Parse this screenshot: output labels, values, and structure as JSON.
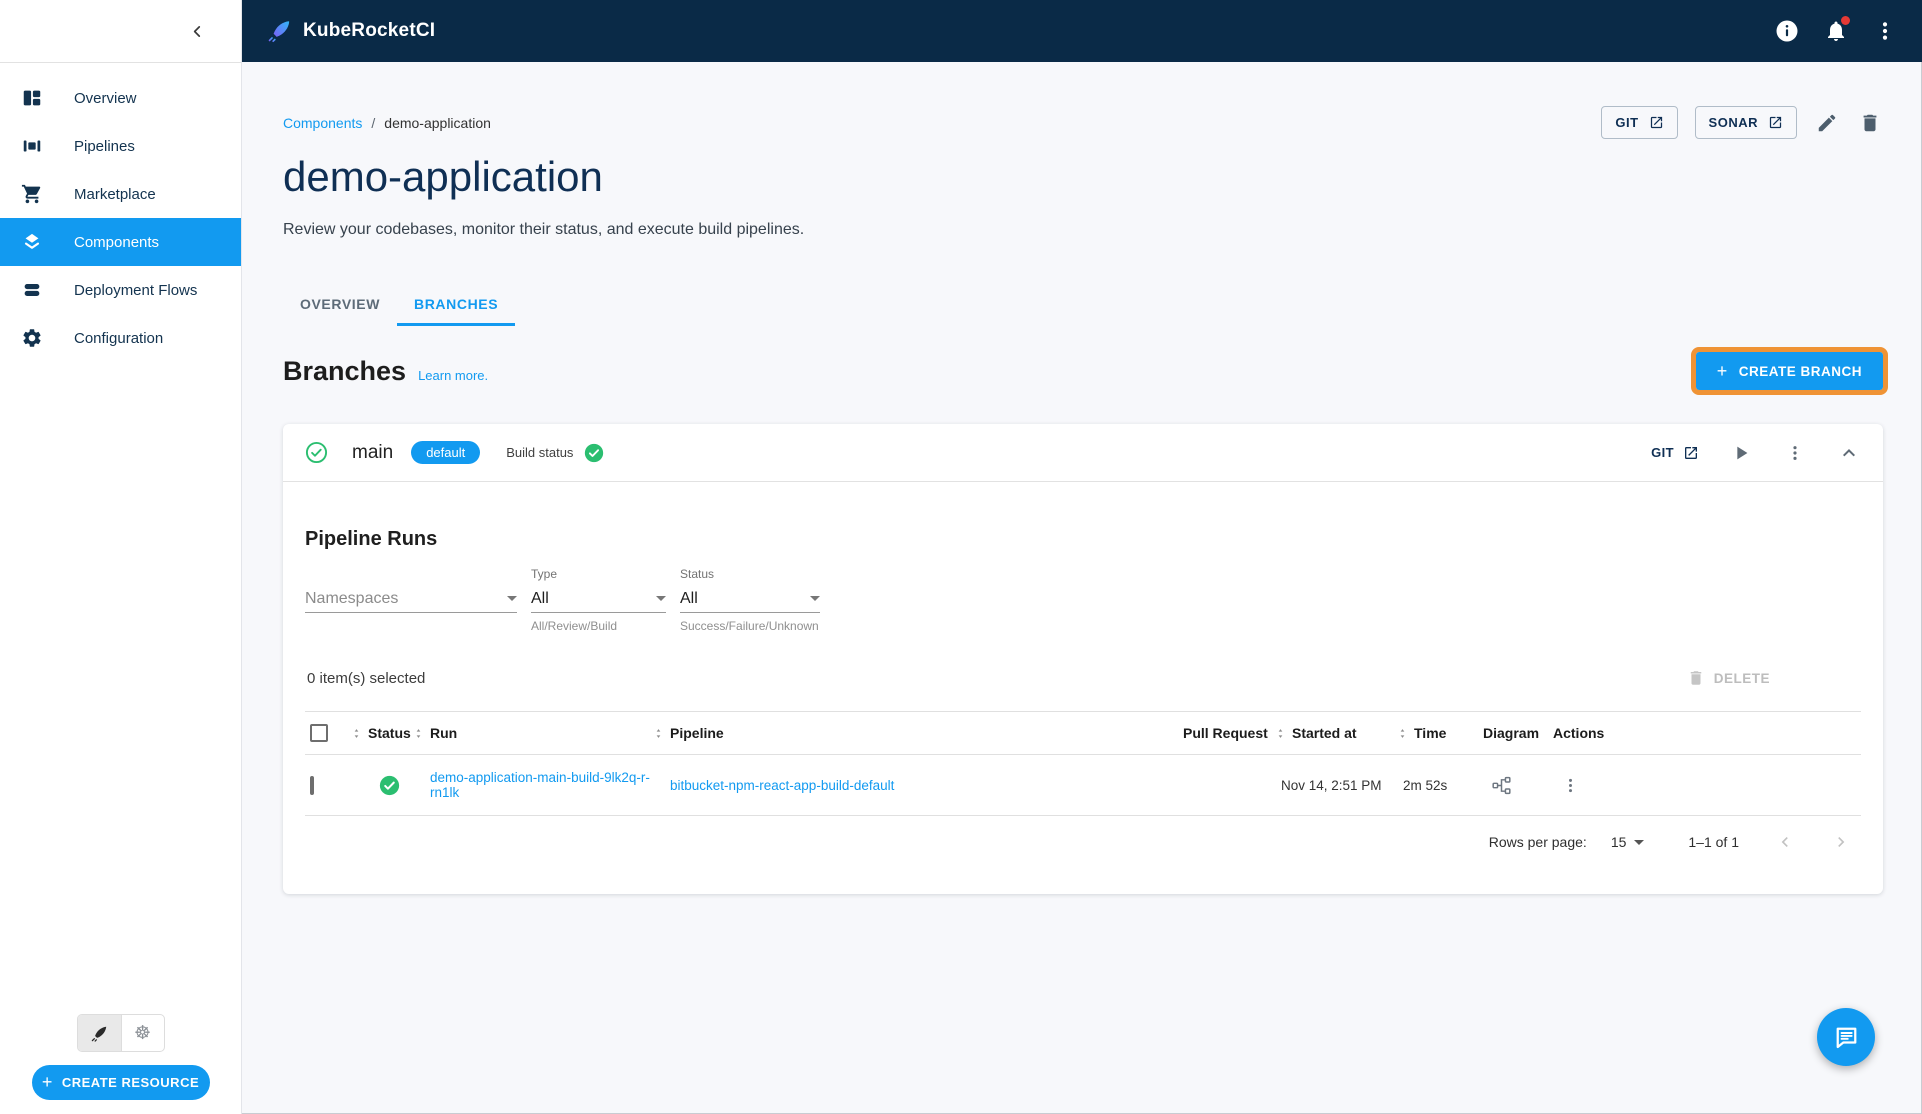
{
  "topbar": {
    "brand": "KubeRocketCI",
    "icons": {
      "info": "info-icon",
      "notifications": "notifications-icon",
      "menu": "kebab-menu-icon"
    }
  },
  "sidebar": {
    "collapse_icon": "chevron-left-icon",
    "items": [
      {
        "label": "Overview",
        "icon": "dashboard-icon",
        "active": false
      },
      {
        "label": "Pipelines",
        "icon": "pipelines-icon",
        "active": false
      },
      {
        "label": "Marketplace",
        "icon": "cart-icon",
        "active": false
      },
      {
        "label": "Components",
        "icon": "layers-icon",
        "active": true
      },
      {
        "label": "Deployment Flows",
        "icon": "stacks-icon",
        "active": false
      },
      {
        "label": "Configuration",
        "icon": "gear-icon",
        "active": false
      }
    ],
    "launcher_icons": [
      "rocket-icon",
      "kubernetes-icon"
    ],
    "create_resource_label": "CREATE RESOURCE"
  },
  "page": {
    "breadcrumb": {
      "parent": "Components",
      "separator": "/",
      "current": "demo-application"
    },
    "actions": {
      "git_label": "GIT",
      "sonar_label": "SONAR",
      "edit_icon": "pencil-icon",
      "delete_icon": "trash-icon"
    },
    "title": "demo-application",
    "subtitle": "Review your codebases, monitor their status, and execute build pipelines.",
    "tabs": [
      {
        "label": "OVERVIEW"
      },
      {
        "label": "BRANCHES"
      }
    ],
    "active_tab": "BRANCHES"
  },
  "branches": {
    "heading": "Branches",
    "learn_more": "Learn more.",
    "create_button": "CREATE BRANCH"
  },
  "branch": {
    "name": "main",
    "default_chip": "default",
    "build_status_label": "Build status",
    "build_status": "success",
    "git_label": "GIT"
  },
  "pipeline_runs": {
    "heading": "Pipeline Runs",
    "filters": {
      "namespaces": {
        "placeholder": "Namespaces"
      },
      "type": {
        "label": "Type",
        "value": "All",
        "helper": "All/Review/Build"
      },
      "status": {
        "label": "Status",
        "value": "All",
        "helper": "Success/Failure/Unknown"
      }
    },
    "selection_text": "0 item(s) selected",
    "delete_label": "DELETE",
    "table": {
      "columns": [
        "Status",
        "Run",
        "Pipeline",
        "Pull Request",
        "Started at",
        "Time",
        "Diagram",
        "Actions"
      ],
      "rows": [
        {
          "status": "success",
          "run": "demo-application-main-build-9lk2q-r-rn1lk",
          "pipeline": "bitbucket-npm-react-app-build-default",
          "pull_request": "",
          "started_at": "Nov 14, 2:51 PM",
          "time": "2m 52s"
        }
      ]
    },
    "pagination": {
      "rows_per_page_label": "Rows per page:",
      "rows_per_page_value": "15",
      "range_text": "1–1 of 1"
    }
  },
  "colors": {
    "accent_blue": "#129af0",
    "topbar_navy": "#0a2a47",
    "success_green": "#2bbe70",
    "highlight_orange": "#ef9335",
    "notification_red": "#e53935"
  }
}
